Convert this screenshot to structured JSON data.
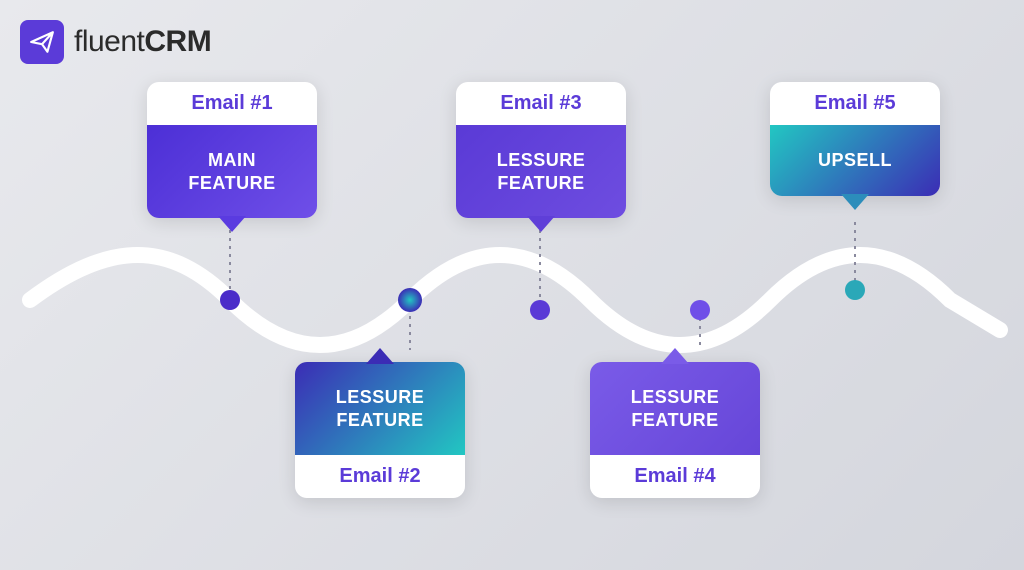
{
  "logo": {
    "name": "fluent",
    "suffix": "CRM"
  },
  "cards": [
    {
      "id": 1,
      "label": "Email #1",
      "title": "MAIN FEATURE",
      "position": "top"
    },
    {
      "id": 2,
      "label": "Email #2",
      "title": "LESSURE FEATURE",
      "position": "bottom"
    },
    {
      "id": 3,
      "label": "Email #3",
      "title": "LESSURE FEATURE",
      "position": "top"
    },
    {
      "id": 4,
      "label": "Email #4",
      "title": "LESSURE FEATURE",
      "position": "bottom"
    },
    {
      "id": 5,
      "label": "Email #5",
      "title": "UPSELL",
      "position": "top"
    }
  ],
  "colors": {
    "brand": "#5b3bd8",
    "teal": "#22c7c2"
  }
}
